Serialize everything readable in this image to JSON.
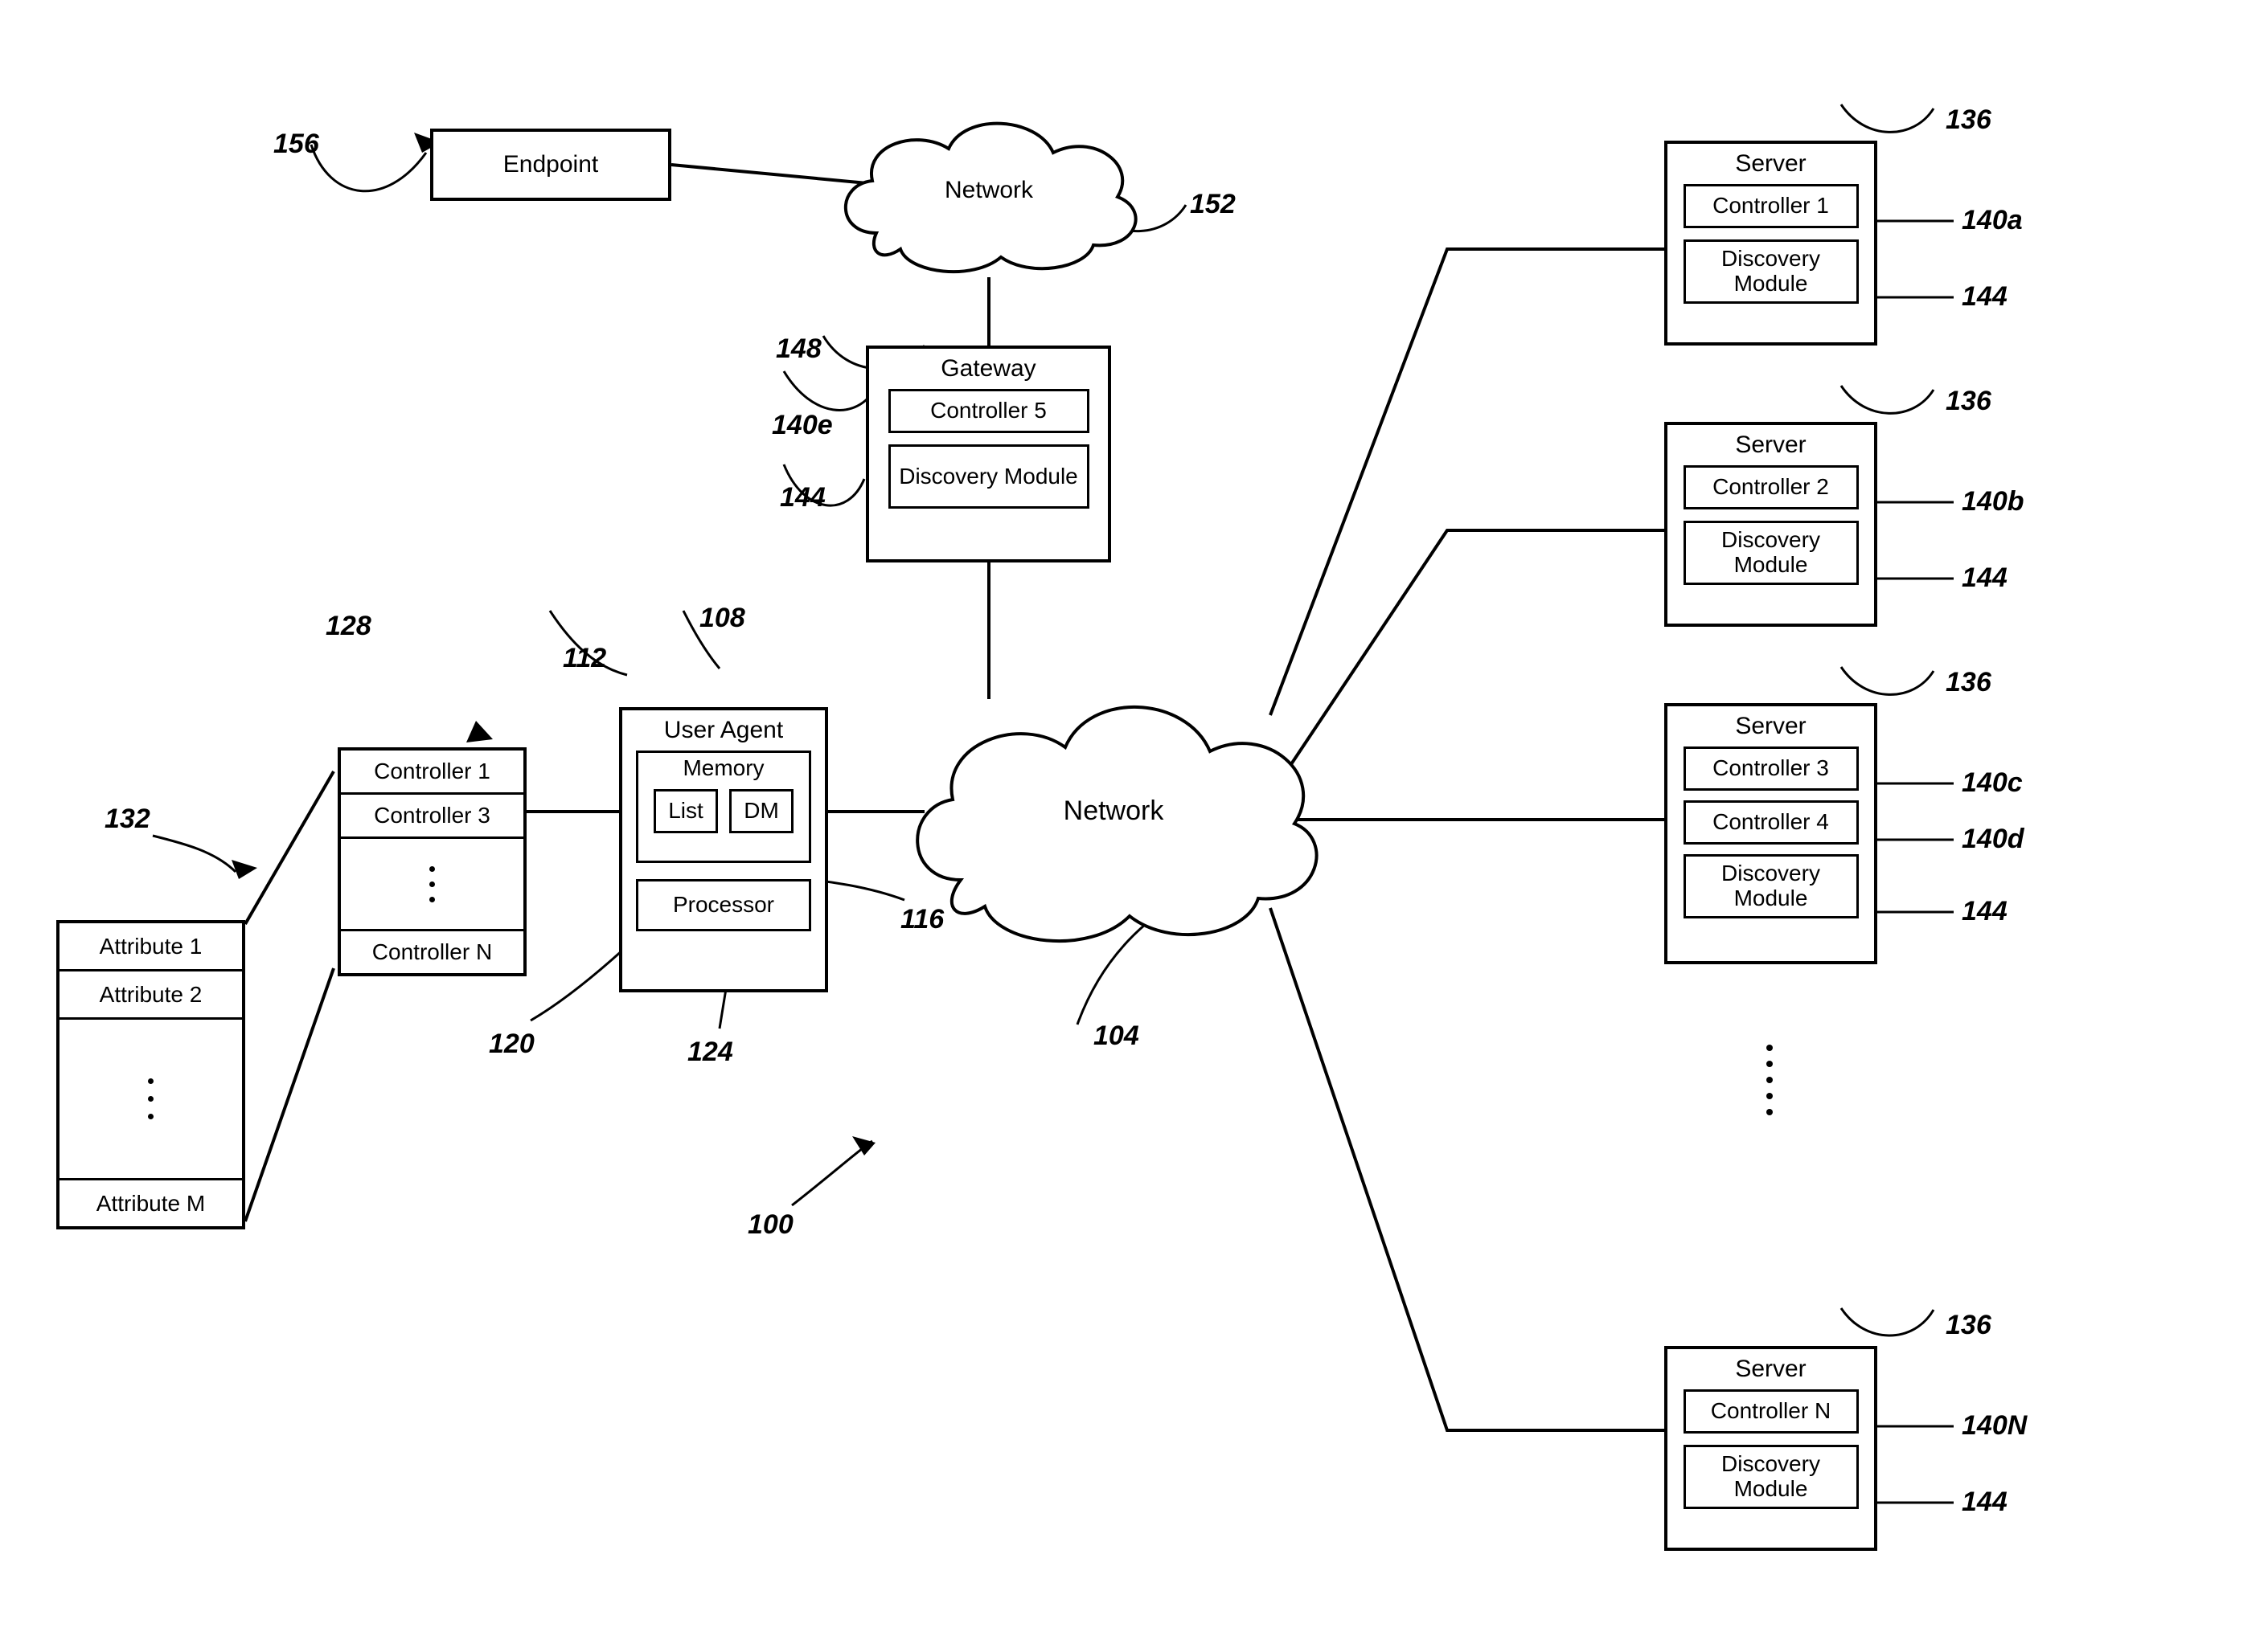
{
  "endpoint": {
    "label": "Endpoint",
    "ref": "156"
  },
  "network_top": {
    "label": "Network",
    "ref": "152"
  },
  "gateway": {
    "label": "Gateway",
    "ref": "148",
    "controller": {
      "label": "Controller 5",
      "ref": "140e"
    },
    "discovery": {
      "label": "Discovery Module",
      "ref": "144"
    }
  },
  "user_agent": {
    "label": "User Agent",
    "ref": "108",
    "memory": {
      "label": "Memory",
      "ref": "112",
      "list": {
        "label": "List",
        "ref": "120"
      },
      "dm": {
        "label": "DM",
        "ref": "116"
      }
    },
    "processor": {
      "label": "Processor",
      "ref": "124"
    }
  },
  "controller_list": {
    "ref": "128",
    "items": [
      {
        "label": "Controller 1"
      },
      {
        "label": "Controller 3"
      },
      {
        "label": "Controller N"
      }
    ]
  },
  "attribute_list": {
    "ref": "132",
    "items": [
      {
        "label": "Attribute 1"
      },
      {
        "label": "Attribute 2"
      },
      {
        "label": "Attribute M"
      }
    ]
  },
  "network_main": {
    "label": "Network",
    "ref": "104"
  },
  "figure_ref": "100",
  "servers": [
    {
      "label": "Server",
      "ref": "136",
      "controllers": [
        {
          "label": "Controller 1",
          "ref": "140a"
        }
      ],
      "discovery": {
        "label": "Discovery Module",
        "ref": "144"
      }
    },
    {
      "label": "Server",
      "ref": "136",
      "controllers": [
        {
          "label": "Controller 2",
          "ref": "140b"
        }
      ],
      "discovery": {
        "label": "Discovery Module",
        "ref": "144"
      }
    },
    {
      "label": "Server",
      "ref": "136",
      "controllers": [
        {
          "label": "Controller 3",
          "ref": "140c"
        },
        {
          "label": "Controller 4",
          "ref": "140d"
        }
      ],
      "discovery": {
        "label": "Discovery Module",
        "ref": "144"
      }
    },
    {
      "label": "Server",
      "ref": "136",
      "controllers": [
        {
          "label": "Controller N",
          "ref": "140N"
        }
      ],
      "discovery": {
        "label": "Discovery Module",
        "ref": "144"
      }
    }
  ]
}
